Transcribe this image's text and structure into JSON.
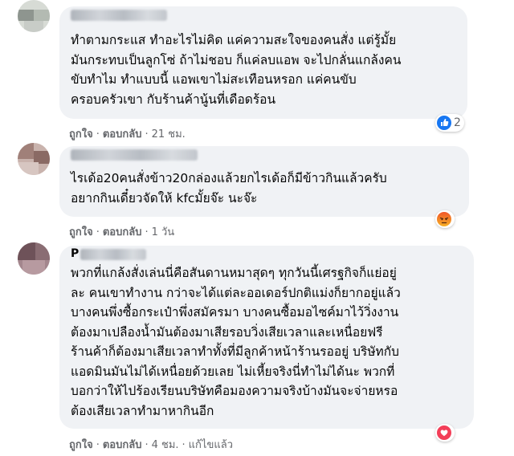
{
  "comments": [
    {
      "text": "ทำตามกระแส ทำอะไรไม่คิด แค่ความสะใจของคนสั่ง แต่รู้มั้ย\nมันกระทบเป็นลูกโซ่ ถ้าไม่ชอบ ก็แค่ลบแอพ จะไปกลั่นแกล้งคน\nขับทำไม ทำแบบนี้ แอพเขาไม่สะเทือนหรอก แค่คนขับ\nครอบครัวเขา กับร้านค้านู้นที่เดือดร้อน",
      "like": "ถูกใจ",
      "reply": "ตอบกลับ",
      "time": "21 ชม.",
      "reaction_icon": "like-icon",
      "reaction_count": "2"
    },
    {
      "text": "ไรเด้อ20คนสั่งข้าว20กล่องแล้วยกไรเด้อก็มีข้าวกินแล้วครับ\nอยากกินเดี๋ยวจัดให้ kfcมั้ยจ๊ะ นะจ๊ะ",
      "like": "ถูกใจ",
      "reply": "ตอบกลับ",
      "time": "1 วัน",
      "reaction_icon": "angry-icon"
    },
    {
      "author_initial": "P",
      "text": "พวกที่แกล้งสั่งเล่นนี่คือสันดานหมาสุดๆ ทุกวันนี้เศรฐกิจก็แย่อยู่\nละ คนเขาทำงาน กว่าจะได้แต่ละออเดอร์ปกติแม่งก็ยากอยู่แล้ว\nบางคนพึ่งซื้อกระเป๋าพึ่งสมัครมา บางคนซื้อมอไซค์มาไว้วิ่งงาน\nต้องมาเปลืองน้ำมันต้องมาเสียรอบวิ่งเสียเวลาและเหนื่อยฟรี\nร้านค้าก็ต้องมาเสียเวลาทำทั้งที่มีลูกค้าหน้าร้านรออยู่ บริษัทกับ\nแอดมินมันไม่ได้เหนื่อยด้วยเลย ไม่เหี้ยจริงนี่ทำไม่ได้นะ พวกที่\nบอกว่าให้ไปร้องเรียนบริษัทคือมองความจริงบ้างมันจะจ่ายหรอ\nต้องเสียเวลาทำมาหากินอีก",
      "like": "ถูกใจ",
      "reply": "ตอบกลับ",
      "time": "4 ชม.",
      "edited": "แก้ไขแล้ว",
      "reaction_icon": "love-icon"
    }
  ],
  "colors": {
    "bubble": "#f0f2f5",
    "meta_text": "#65676b",
    "like_blue": "#1877f2",
    "love_red": "#f33e58",
    "angry_orange": "#e9710f"
  }
}
